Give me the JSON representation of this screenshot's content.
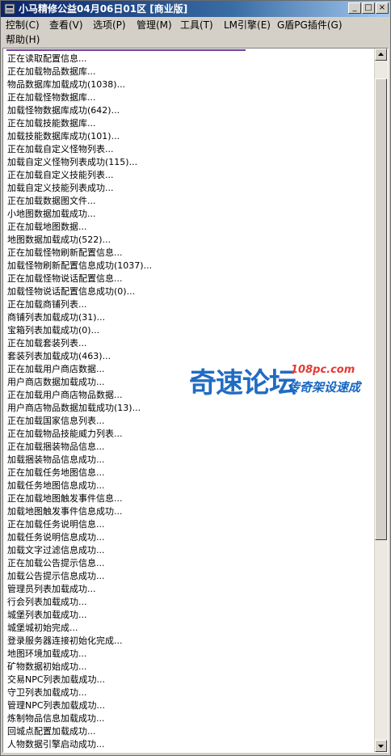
{
  "window": {
    "title": "小马精修公益04月06日01区 [商业版]",
    "controls": {
      "minimize": "_",
      "maximize": "□",
      "close": "×"
    }
  },
  "menu": {
    "row1": [
      "控制(C)",
      "查看(V)",
      "选项(P)",
      "管理(M)",
      "工具(T)",
      "LM引擎(E)",
      "G盾PG插件(G)"
    ],
    "row2": [
      "帮助(H)"
    ]
  },
  "log": [
    "正在读取配置信息...",
    "正在加载物品数据库...",
    "物品数据库加载成功(1038)...",
    "正在加载怪物数据库...",
    "加载怪物数据库成功(642)...",
    "正在加载技能数据库...",
    "加载技能数据库成功(101)...",
    "正在加载自定义怪物列表...",
    "加载自定义怪物列表成功(115)...",
    "正在加载自定义技能列表...",
    "加载自定义技能列表成功...",
    "正在加载数据图文件...",
    "小地图数据加载成功...",
    "正在加载地图数据...",
    "地图数据加载成功(522)...",
    "正在加载怪物刷新配置信息...",
    "加载怪物刷新配置信息成功(1037)...",
    "正在加载怪物说话配置信息...",
    "加载怪物说话配置信息成功(0)...",
    "正在加载商铺列表...",
    "商铺列表加载成功(31)...",
    "宝箱列表加载成功(0)...",
    "正在加载套装列表...",
    "套装列表加载成功(463)...",
    "正在加载用户商店数据...",
    "用户商店数据加载成功...",
    "正在加载用户商店物品数据...",
    "用户商店物品数据加载成功(13)...",
    "正在加载国家信息列表...",
    "正在加载物品技能威力列表...",
    "正在加载捆装物品信息...",
    "加载捆装物品信息成功...",
    "正在加载任务地图信息...",
    "加载任务地图信息成功...",
    "正在加载地图触发事件信息...",
    "加载地图触发事件信息成功...",
    "正在加载任务说明信息...",
    "加载任务说明信息成功...",
    "加载文字过滤信息成功...",
    "正在加载公告提示信息...",
    "加载公告提示信息成功...",
    "管理员列表加载成功...",
    "行会列表加载成功...",
    "城堡列表加载成功...",
    "城堡城初始完成...",
    "登录服务器连接初始化完成...",
    "地图环境加载成功...",
    "矿物数据初始成功...",
    "交易NPC列表加载成功...",
    "守卫列表加载成功...",
    "管理NPC列表加载成功...",
    "炼制物品信息加载成功...",
    "回城点配置加载成功...",
    "人物数据引擎启动成功..."
  ],
  "watermark": {
    "logo": "奇速论坛",
    "url": "108pc.com",
    "tagline": "传奇架设速成"
  },
  "scrollbar": {
    "position": 0.08,
    "visible_fraction": 0.68
  }
}
